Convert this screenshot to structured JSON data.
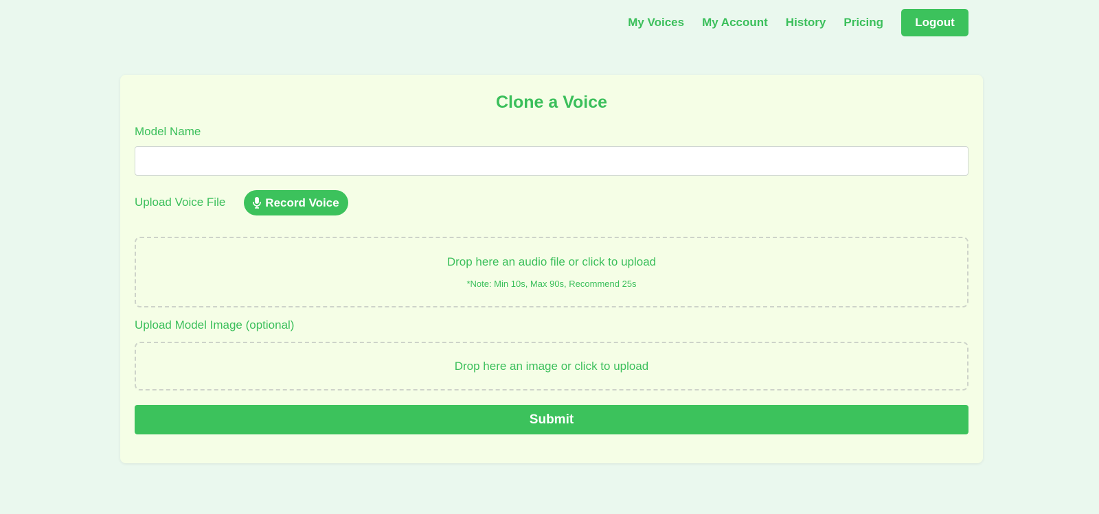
{
  "nav": {
    "links": [
      "My Voices",
      "My Account",
      "History",
      "Pricing"
    ],
    "logout_label": "Logout"
  },
  "form": {
    "title": "Clone a Voice",
    "model_name_label": "Model Name",
    "model_name_value": "",
    "upload_voice_label": "Upload Voice File",
    "record_label": "Record Voice",
    "audio_drop_text": "Drop here an audio file or click to upload",
    "audio_drop_note": "*Note: Min 10s, Max 90s, Recommend 25s",
    "upload_image_label": "Upload Model Image (optional)",
    "image_drop_text": "Drop here an image or click to upload",
    "submit_label": "Submit"
  },
  "icons": {
    "record": "microphone-icon"
  },
  "colors": {
    "accent": "#3cc25c",
    "page_bg": "#eaf8ee",
    "card_bg": "#f5fee6"
  }
}
